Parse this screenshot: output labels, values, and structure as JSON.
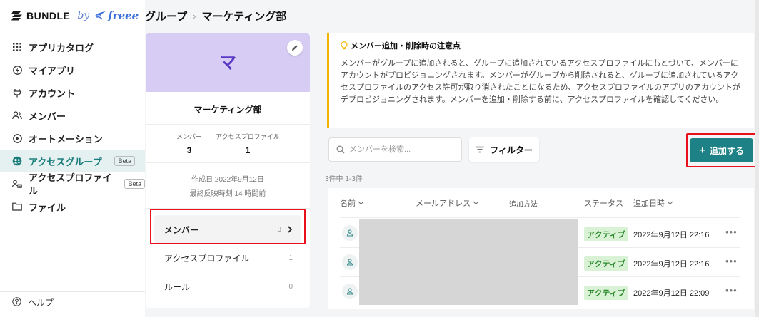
{
  "brand": {
    "name": "BUNDLE",
    "by": "by",
    "partner": "freee"
  },
  "breadcrumb": {
    "parent": "グループ",
    "separator": "›",
    "current": "マーケティング部"
  },
  "sidebar": {
    "items": [
      {
        "label": "アプリカタログ",
        "icon": "grid-icon"
      },
      {
        "label": "マイアプリ",
        "icon": "bolt-circle-icon"
      },
      {
        "label": "アカウント",
        "icon": "plug-icon"
      },
      {
        "label": "メンバー",
        "icon": "users-icon"
      },
      {
        "label": "オートメーション",
        "icon": "play-circle-icon"
      },
      {
        "label": "アクセスグループ",
        "icon": "group-icon",
        "badge": "Beta",
        "active": true
      },
      {
        "label": "アクセスプロファイル",
        "icon": "profile-icon",
        "badge": "Beta"
      },
      {
        "label": "ファイル",
        "icon": "folder-icon"
      }
    ],
    "help": "ヘルプ"
  },
  "group": {
    "initial": "マ",
    "name": "マーケティング部",
    "stats": [
      {
        "label": "メンバー",
        "value": "3"
      },
      {
        "label": "アクセスプロファイル",
        "value": "1"
      }
    ],
    "created": "作成日 2022年9月12日",
    "last_reflected": "最終反映時刻 14 時間前",
    "tabs": [
      {
        "label": "メンバー",
        "count": "3",
        "active": true
      },
      {
        "label": "アクセスプロファイル",
        "count": "1"
      },
      {
        "label": "ルール",
        "count": "0"
      }
    ]
  },
  "notice": {
    "title": "メンバー追加・削除時の注意点",
    "body": "メンバーがグループに追加されると、グループに追加されているアクセスプロファイルにもとづいて、メンバーにアカウントがプロビジョニングされます。メンバーがグループから削除されると、グループに追加されているアクセスプロファイルのアクセス許可が取り消されたことになるため、アクセスプロファイルのアプリのアカウントがデプロビジョニングされます。メンバーを追加・削除する前に、アクセスプロファイルを確認してください。"
  },
  "toolbar": {
    "search_placeholder": "メンバーを検索...",
    "filter_label": "フィルター",
    "add_label": "追加する"
  },
  "table": {
    "count_text": "3件中 1-3件",
    "headers": {
      "name": "名前",
      "email": "メールアドレス",
      "method": "追加方法",
      "status": "ステータス",
      "added_at": "追加日時"
    },
    "rows": [
      {
        "status": "アクティブ",
        "added_at": "2022年9月12日 22:16"
      },
      {
        "status": "アクティブ",
        "added_at": "2022年9月12日 22:16"
      },
      {
        "status": "アクティブ",
        "added_at": "2022年9月12日 22:09"
      }
    ]
  },
  "colors": {
    "accent": "#1e8185",
    "active_nav_bg": "#e4f1f0",
    "banner": "#d6ccf4",
    "notice_border": "#f4b400",
    "highlight": "#e8101a",
    "status_bg": "#d9f2d5"
  }
}
